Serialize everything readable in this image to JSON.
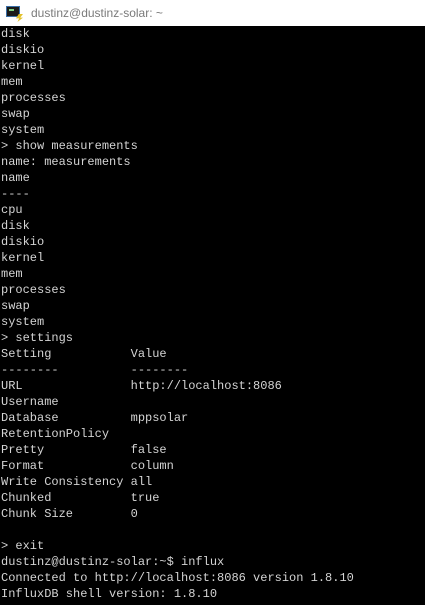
{
  "window": {
    "title": "dustinz@dustinz-solar: ~",
    "icon": "putty-terminal-icon"
  },
  "terminal": {
    "lines": [
      "disk",
      "diskio",
      "kernel",
      "mem",
      "processes",
      "swap",
      "system",
      "> show measurements",
      "name: measurements",
      "name",
      "----",
      "cpu",
      "disk",
      "diskio",
      "kernel",
      "mem",
      "processes",
      "swap",
      "system",
      "> settings",
      "Setting           Value",
      "--------          --------",
      "URL               http://localhost:8086",
      "Username",
      "Database          mppsolar",
      "RetentionPolicy",
      "Pretty            false",
      "Format            column",
      "Write Consistency all",
      "Chunked           true",
      "Chunk Size        0",
      "",
      "> exit",
      "dustinz@dustinz-solar:~$ influx",
      "Connected to http://localhost:8086 version 1.8.10",
      "InfluxDB shell version: 1.8.10"
    ]
  }
}
